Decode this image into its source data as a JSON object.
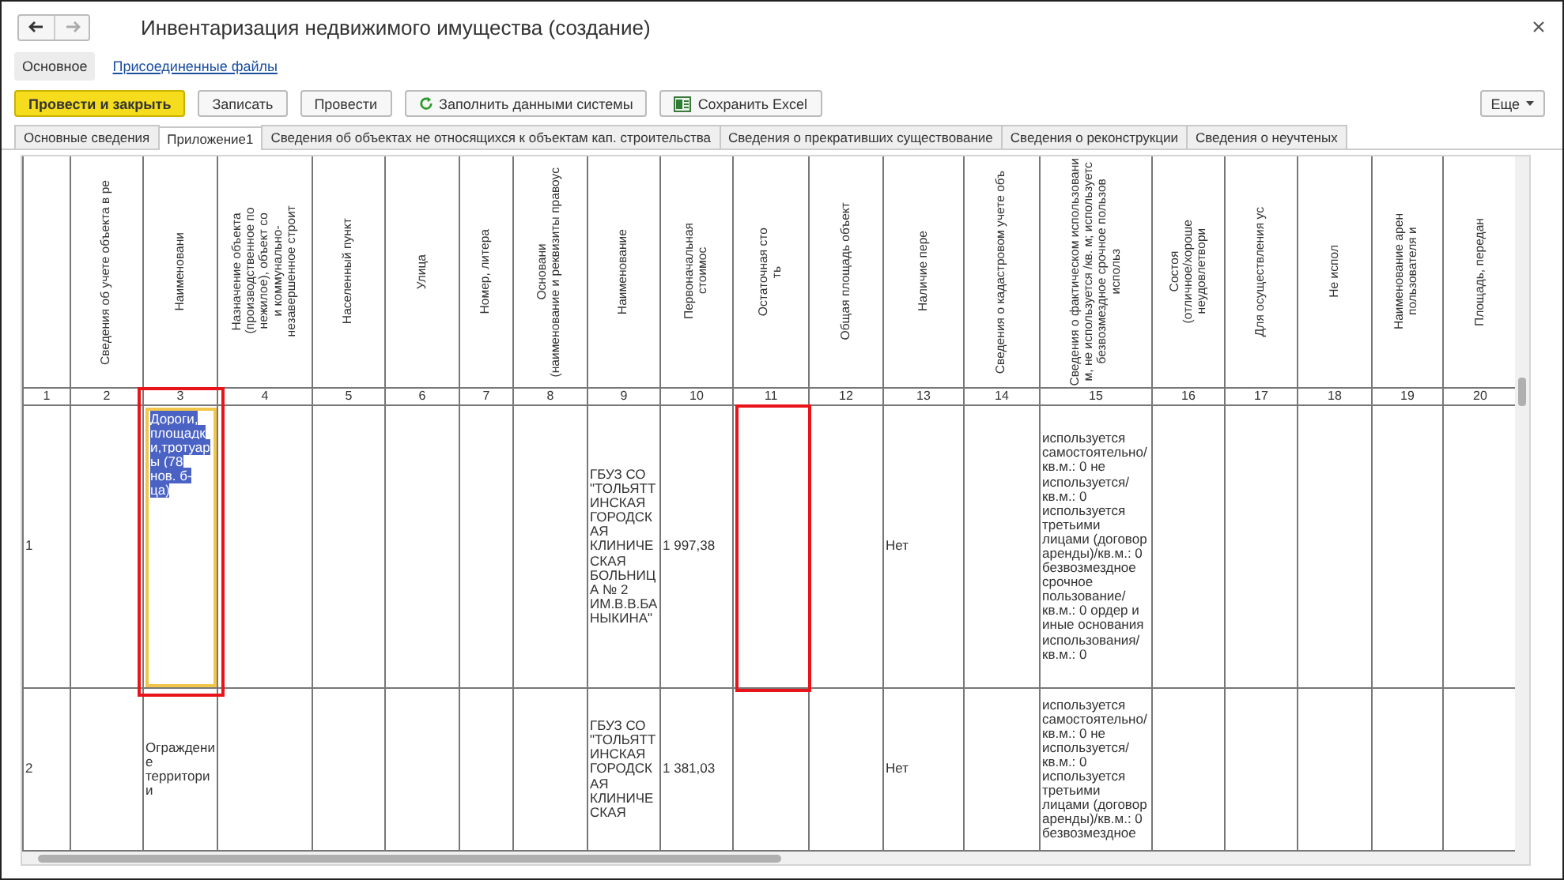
{
  "window": {
    "title": "Инвентаризация недвижимого имущества (создание)"
  },
  "sections": [
    {
      "label": "Основное",
      "selected": true
    },
    {
      "label": "Присоединенные файлы",
      "selected": false
    }
  ],
  "toolbar": {
    "buttons": [
      {
        "label": "Провести и закрыть",
        "kind": "primary"
      },
      {
        "label": "Записать",
        "kind": "plain"
      },
      {
        "label": "Провести",
        "kind": "plain"
      },
      {
        "label": "Заполнить данными системы",
        "kind": "refresh"
      },
      {
        "label": "Сохранить Excel",
        "kind": "excel"
      }
    ],
    "more": "Еще"
  },
  "tabs": [
    {
      "label": "Основные сведения",
      "selected": false
    },
    {
      "label": "Приложение1",
      "selected": true
    },
    {
      "label": "Сведения об объектах не относящихся к объектам кап. строительства",
      "selected": false
    },
    {
      "label": "Сведения о прекративших существование",
      "selected": false
    },
    {
      "label": "Сведения о реконструкции",
      "selected": false
    },
    {
      "label": "Сведения о неучтеных",
      "selected": false
    }
  ],
  "table": {
    "columns": [
      {
        "number": "1"
      },
      {
        "number": "2",
        "header": [
          "Сведения об учете объекта в ре"
        ]
      },
      {
        "number": "3",
        "header": [
          "Наименовани"
        ]
      },
      {
        "number": "4",
        "header": [
          "Назначение объекта",
          "(производственное по",
          "нежилое), объект со",
          "и коммунально-",
          "незавершенное строит"
        ]
      },
      {
        "number": "5",
        "header": [
          "Населенный пункт"
        ]
      },
      {
        "number": "6",
        "header": [
          "Улица"
        ]
      },
      {
        "number": "7",
        "header": [
          "Номер, литера"
        ]
      },
      {
        "number": "8",
        "header": [
          "Основани",
          "(наименование и реквизиты правоус"
        ]
      },
      {
        "number": "9",
        "header": [
          "Наименование"
        ]
      },
      {
        "number": "10",
        "header": [
          "Первоначальная",
          "стоимос"
        ]
      },
      {
        "number": "11",
        "header": [
          "Остаточная сто",
          "ть"
        ]
      },
      {
        "number": "12",
        "header": [
          "Общая площадь объект"
        ]
      },
      {
        "number": "13",
        "header": [
          "Наличие пере"
        ]
      },
      {
        "number": "14",
        "header": [
          "Сведения о кадастровом учете объ"
        ]
      },
      {
        "number": "15",
        "header": [
          "Сведения о фактическом использовани",
          "м, не используется /кв. м; используетс",
          "безвозмездное срочное пользов",
          "использ"
        ]
      },
      {
        "number": "16",
        "header": [
          "Состоя",
          "(отличное/хороше",
          "неудовлетвори"
        ]
      },
      {
        "number": "17",
        "header": [
          "Для осуществления ус"
        ]
      },
      {
        "number": "18",
        "header": [
          "Не испол"
        ]
      },
      {
        "number": "19",
        "header": [
          "Наименование арен",
          "пользователя и"
        ]
      },
      {
        "number": "20",
        "header": [
          "Площадь, передан"
        ]
      }
    ],
    "rows": [
      {
        "cells": [
          {
            "text": "1",
            "selected": false,
            "framed": false
          },
          {
            "selected": false,
            "framed": false
          },
          {
            "text": "Дороги, площадки,тротуары (78 нов. б-ца)",
            "selected": true,
            "framed": true
          },
          {
            "selected": false,
            "framed": false
          },
          {
            "selected": false,
            "framed": false
          },
          {
            "selected": false,
            "framed": false
          },
          {
            "selected": false,
            "framed": false
          },
          {
            "selected": false,
            "framed": false
          },
          {
            "text": "ГБУЗ СО \"ТОЛЬЯТТИНСКАЯ ГОРОДСКАЯ КЛИНИЧЕСКАЯ БОЛЬНИЦА № 2 ИМ.В.В.БАНЫКИНА\"",
            "selected": false,
            "framed": false
          },
          {
            "text": "1 997,38",
            "selected": false,
            "framed": false
          },
          {
            "selected": false,
            "framed": true
          },
          {
            "selected": false,
            "framed": false
          },
          {
            "text": "Нет",
            "selected": false,
            "framed": false
          },
          {
            "selected": false,
            "framed": false
          },
          {
            "text": "используется самостоятельно/кв.м.: 0 не используется/кв.м.: 0 используется третьими лицами (договор аренды)/кв.м.: 0 безвозмездное срочное пользование/кв.м.: 0 ордер и иные основания использования/кв.м.: 0",
            "selected": false,
            "framed": false
          },
          {
            "selected": false,
            "framed": false
          },
          {
            "selected": false,
            "framed": false
          },
          {
            "selected": false,
            "framed": false
          },
          {
            "selected": false,
            "framed": false
          },
          {
            "selected": false,
            "framed": false
          }
        ]
      },
      {
        "cells": [
          {
            "text": "2",
            "selected": false,
            "framed": false
          },
          {
            "selected": false,
            "framed": false
          },
          {
            "text": "Ограждение территории",
            "selected": false,
            "framed": false
          },
          {
            "selected": false,
            "framed": false
          },
          {
            "selected": false,
            "framed": false
          },
          {
            "selected": false,
            "framed": false
          },
          {
            "selected": false,
            "framed": false
          },
          {
            "selected": false,
            "framed": false
          },
          {
            "text": "ГБУЗ СО \"ТОЛЬЯТТИНСКАЯ ГОРОДСКАЯ КЛИНИЧЕСКАЯ",
            "selected": false,
            "framed": false
          },
          {
            "text": "1 381,03",
            "selected": false,
            "framed": false
          },
          {
            "selected": false,
            "framed": false
          },
          {
            "selected": false,
            "framed": false
          },
          {
            "text": "Нет",
            "selected": false,
            "framed": false
          },
          {
            "selected": false,
            "framed": false
          },
          {
            "text": "используется самостоятельно/кв.м.: 0 не используется/кв.м.: 0 используется третьими лицами (договор аренды)/кв.м.: 0 безвозмездное",
            "selected": false,
            "framed": false
          },
          {
            "selected": false,
            "framed": false
          },
          {
            "selected": false,
            "framed": false
          },
          {
            "selected": false,
            "framed": false
          },
          {
            "selected": false,
            "framed": false
          },
          {
            "selected": false,
            "framed": false
          }
        ]
      }
    ]
  }
}
